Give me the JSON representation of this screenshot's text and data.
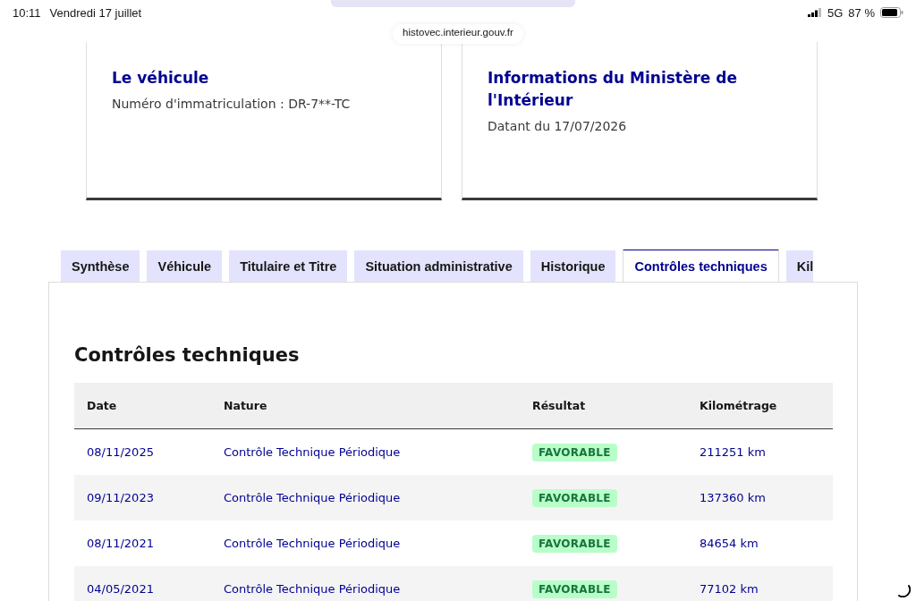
{
  "status_bar": {
    "time": "10:11",
    "date": "Vendredi 17 juillet",
    "network": "5G",
    "battery": "87 %"
  },
  "address_bar": {
    "url": "histovec.interieur.gouv.fr"
  },
  "cards": [
    {
      "title": "Le véhicule",
      "text": "Numéro d'immatriculation : DR-7**-TC"
    },
    {
      "title": "Informations du Ministère de l'Intérieur",
      "text": "Datant du 17/07/2026"
    }
  ],
  "tabs": [
    {
      "label": "Synthèse",
      "selected": false
    },
    {
      "label": "Véhicule",
      "selected": false
    },
    {
      "label": "Titulaire et Titre",
      "selected": false
    },
    {
      "label": "Situation administrative",
      "selected": false
    },
    {
      "label": "Historique",
      "selected": false
    },
    {
      "label": "Contrôles techniques",
      "selected": true
    },
    {
      "label": "Kil",
      "selected": false
    }
  ],
  "section_title": "Contrôles techniques",
  "table": {
    "columns": [
      "Date",
      "Nature",
      "Résultat",
      "Kilométrage"
    ],
    "rows": [
      {
        "date": "08/11/2025",
        "nature": "Contrôle Technique Périodique",
        "result": "FAVORABLE",
        "mileage": "211251 km"
      },
      {
        "date": "09/11/2023",
        "nature": "Contrôle Technique Périodique",
        "result": "FAVORABLE",
        "mileage": "137360 km"
      },
      {
        "date": "08/11/2021",
        "nature": "Contrôle Technique Périodique",
        "result": "FAVORABLE",
        "mileage": "84654 km"
      },
      {
        "date": "04/05/2021",
        "nature": "Contrôle Technique Périodique",
        "result": "FAVORABLE",
        "mileage": "77102 km"
      }
    ]
  }
}
